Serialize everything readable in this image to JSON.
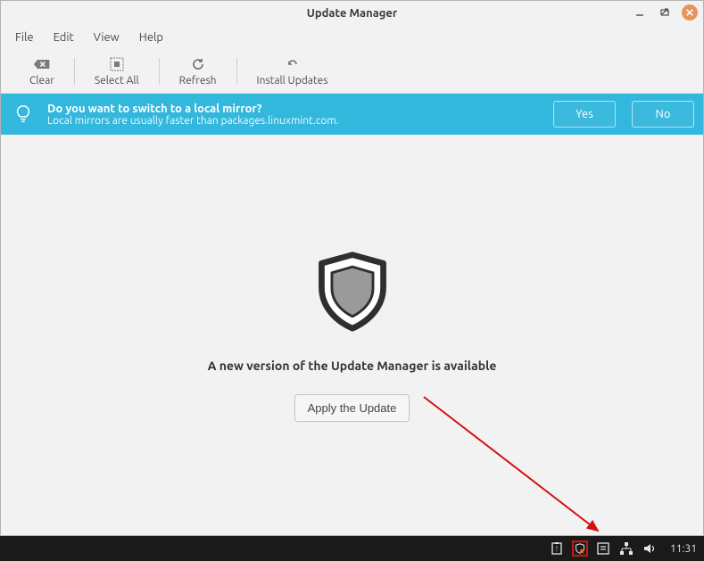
{
  "window": {
    "title": "Update Manager"
  },
  "menubar": [
    "File",
    "Edit",
    "View",
    "Help"
  ],
  "toolbar": {
    "clear": "Clear",
    "select_all": "Select All",
    "refresh": "Refresh",
    "install": "Install Updates"
  },
  "banner": {
    "question": "Do you want to switch to a local mirror?",
    "detail": "Local mirrors are usually faster than packages.linuxmint.com.",
    "yes": "Yes",
    "no": "No"
  },
  "content": {
    "message": "A new version of the Update Manager is available",
    "apply": "Apply the Update"
  },
  "taskbar": {
    "time": "11:31"
  }
}
